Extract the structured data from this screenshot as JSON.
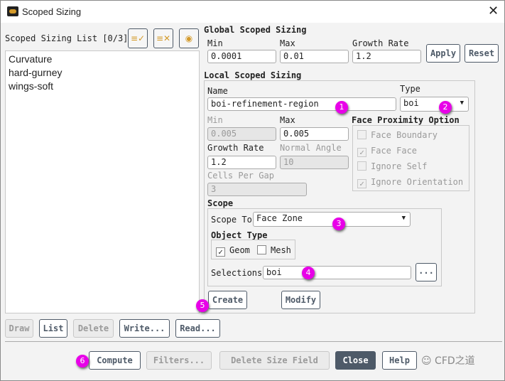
{
  "window": {
    "title": "Scoped Sizing",
    "close": "✕"
  },
  "list": {
    "label": "Scoped Sizing List [0/3]",
    "items": [
      "Curvature",
      "hard-gurney",
      "wings-soft"
    ]
  },
  "global": {
    "header": "Global Scoped Sizing",
    "min_label": "Min",
    "min": "0.0001",
    "max_label": "Max",
    "max": "0.01",
    "growth_label": "Growth Rate",
    "growth": "1.2",
    "apply": "Apply",
    "reset": "Reset"
  },
  "local": {
    "header": "Local Scoped Sizing",
    "name_label": "Name",
    "name": "boi-refinement-region",
    "type_label": "Type",
    "type": "boi",
    "min_label": "Min",
    "min": "0.005",
    "max_label": "Max",
    "max": "0.005",
    "growth_label": "Growth Rate",
    "growth": "1.2",
    "normal_label": "Normal Angle",
    "normal": "10",
    "cells_label": "Cells Per Gap",
    "cells": "3"
  },
  "proximity": {
    "header": "Face Proximity Option",
    "options": [
      {
        "label": "Face Boundary",
        "checked": false
      },
      {
        "label": "Face Face",
        "checked": true
      },
      {
        "label": "Ignore Self",
        "checked": false
      },
      {
        "label": "Ignore Orientation",
        "checked": true
      }
    ]
  },
  "scope": {
    "header": "Scope",
    "scope_to_label": "Scope To",
    "scope_to": "Face Zone",
    "object_type": "Object Type",
    "geom": "Geom",
    "mesh": "Mesh",
    "selections_label": "Selections",
    "selections": "boi",
    "more": "..."
  },
  "actions": {
    "create": "Create",
    "modify": "Modify",
    "draw": "Draw",
    "list": "List",
    "delete": "Delete",
    "write": "Write...",
    "read": "Read..."
  },
  "footer": {
    "compute": "Compute",
    "filters": "Filters...",
    "delete_field": "Delete Size Field",
    "close": "Close",
    "help": "Help"
  },
  "badges": [
    "1",
    "2",
    "3",
    "4",
    "5",
    "6"
  ],
  "watermark": "CFD之道"
}
